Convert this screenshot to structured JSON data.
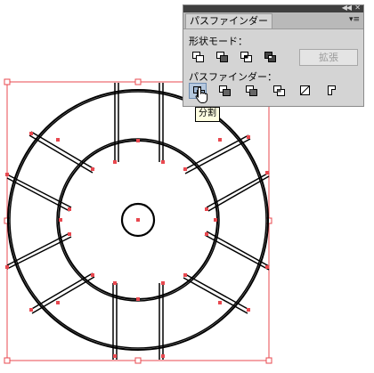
{
  "panel": {
    "tab_title": "パスファインダー",
    "shape_modes_label": "形状モード：",
    "expand_label": "拡張",
    "pathfinders_label": "パスファインダー：",
    "shape_mode_buttons": [
      "add-to-shape-area",
      "subtract-from-shape-area",
      "intersect-shape-areas",
      "exclude-overlapping-shape-areas"
    ],
    "pathfinder_buttons": [
      "divide",
      "trim",
      "merge",
      "crop",
      "outline",
      "minus-back"
    ],
    "pressed_button": "divide"
  },
  "tooltip": {
    "text": "分割"
  },
  "colors": {
    "selection": "#e8484f",
    "stroke": "#000000",
    "panel_bg": "#d4d4d4",
    "titlebar": "#3f3f3f"
  },
  "icons": [
    "double-chevron-icon",
    "close-icon",
    "panel-menu-icon",
    "hand-cursor-icon"
  ]
}
